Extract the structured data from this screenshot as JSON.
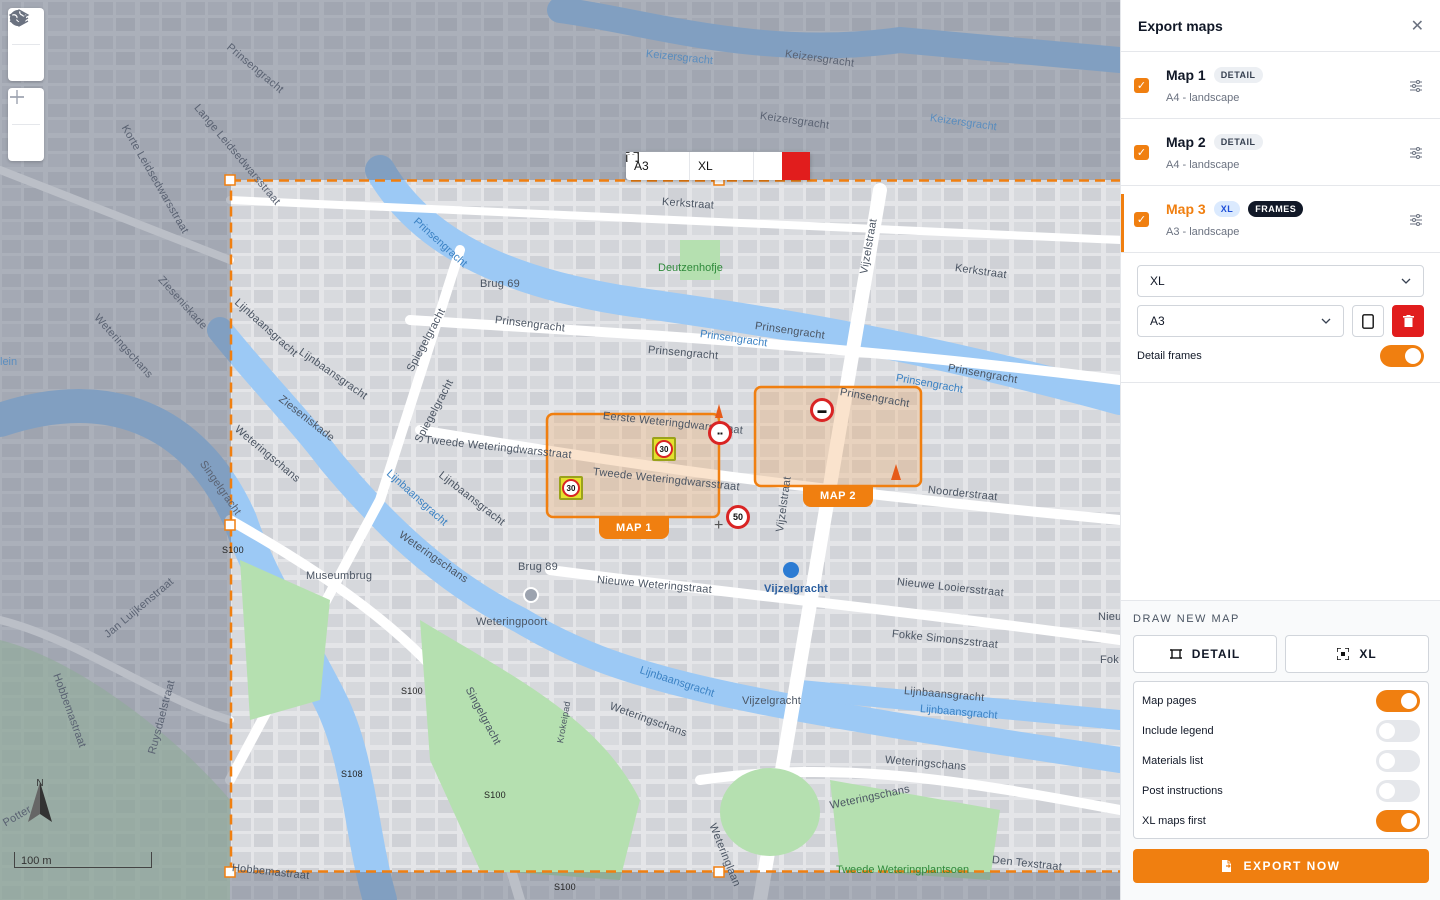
{
  "map": {
    "streets": [
      "Kerkstraat",
      "Keizersgracht",
      "Prinsengracht",
      "Vijzelstraat",
      "Spiegelgracht",
      "Lijnbaansgracht",
      "Zieseniskade",
      "Weteringschans",
      "Tweede Weteringdwarsstraat",
      "Eerste Weteringdwarsstraat",
      "Noorderstraat",
      "Nieuwe Weteringstraat",
      "Nieuwe Looiersstraat",
      "Fokke Simonszstraat",
      "Den Texstraat",
      "Hobbemastraat",
      "Singelgracht",
      "Jan Luijkenstraat",
      "Korte Leidsedwarsstraat",
      "Lange Leidsedwarsstraat",
      "Vijzelgracht",
      "Brug 69",
      "Brug 89",
      "Museumbrug",
      "Weteringpoort",
      "Deutzenhofje",
      "Krokeipad",
      "Weteringlaan",
      "Nieu",
      "Fok",
      "Potter",
      "Ruysdaelstraat",
      "Tweede Weteringplantsoen"
    ],
    "road_shields": [
      "S100",
      "S100",
      "S100",
      "S108",
      "S100"
    ],
    "scale_label": "100 m",
    "north_label": "N",
    "water_partial": "lein",
    "toolbar": {
      "format": "A3",
      "size": "XL"
    },
    "frames": [
      {
        "label": "MAP 1"
      },
      {
        "label": "MAP 2"
      }
    ],
    "signs": [
      "30",
      "30",
      "50"
    ]
  },
  "panel": {
    "title": "Export maps",
    "maps": [
      {
        "name": "Map 1",
        "badges": [
          "DETAIL"
        ],
        "subtitle": "A4 - landscape",
        "checked": true,
        "active": false
      },
      {
        "name": "Map 2",
        "badges": [
          "DETAIL"
        ],
        "subtitle": "A4 - landscape",
        "checked": true,
        "active": false
      },
      {
        "name": "Map 3",
        "badges": [
          "XL",
          "FRAMES"
        ],
        "subtitle": "A3 - landscape",
        "checked": true,
        "active": true
      }
    ],
    "settings": {
      "size_select": "XL",
      "format_select": "A3",
      "detail_frames_label": "Detail frames",
      "detail_frames_on": true
    },
    "draw": {
      "title": "DRAW NEW MAP",
      "detail_label": "DETAIL",
      "xl_label": "XL"
    },
    "options": [
      {
        "label": "Map pages",
        "on": true
      },
      {
        "label": "Include legend",
        "on": false
      },
      {
        "label": "Materials list",
        "on": false
      },
      {
        "label": "Post instructions",
        "on": false
      },
      {
        "label": "XL maps first",
        "on": true
      }
    ],
    "export_label": "EXPORT NOW",
    "accent": "#f07f10",
    "danger": "#e11d1d"
  }
}
